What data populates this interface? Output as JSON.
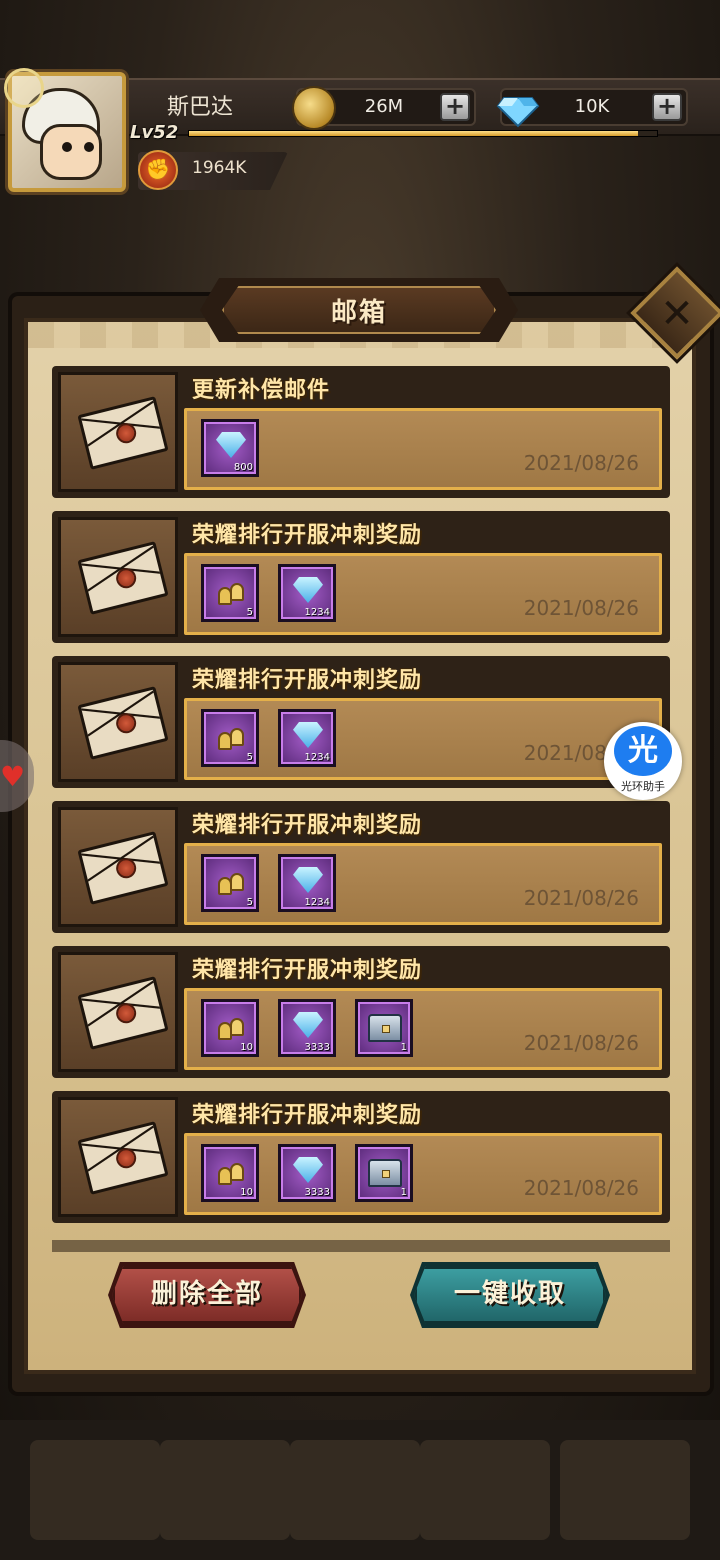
{
  "header": {
    "player_name": "斯巴达",
    "level": "Lv52",
    "power": "1964K",
    "gold": "26M",
    "gems": "10K",
    "xp_progress": 0.96
  },
  "mailbox": {
    "title": "邮箱",
    "close_icon": "close-icon",
    "mails": [
      {
        "title": "更新补偿邮件",
        "date": "2021/08/26",
        "rewards": [
          {
            "icon": "gem-icon",
            "count": "800"
          }
        ]
      },
      {
        "title": "荣耀排行开服冲刺奖励",
        "date": "2021/08/26",
        "rewards": [
          {
            "icon": "bell-icon",
            "count": "5"
          },
          {
            "icon": "gem-icon",
            "count": "1234"
          }
        ]
      },
      {
        "title": "荣耀排行开服冲刺奖励",
        "date": "2021/08/26",
        "rewards": [
          {
            "icon": "bell-icon",
            "count": "5"
          },
          {
            "icon": "gem-icon",
            "count": "1234"
          }
        ]
      },
      {
        "title": "荣耀排行开服冲刺奖励",
        "date": "2021/08/26",
        "rewards": [
          {
            "icon": "bell-icon",
            "count": "5"
          },
          {
            "icon": "gem-icon",
            "count": "1234"
          }
        ]
      },
      {
        "title": "荣耀排行开服冲刺奖励",
        "date": "2021/08/26",
        "rewards": [
          {
            "icon": "bell-icon",
            "count": "10"
          },
          {
            "icon": "gem-icon",
            "count": "3333"
          },
          {
            "icon": "chest-icon",
            "count": "1"
          }
        ]
      },
      {
        "title": "荣耀排行开服冲刺奖励",
        "date": "2021/08/26",
        "rewards": [
          {
            "icon": "bell-icon",
            "count": "10"
          },
          {
            "icon": "gem-icon",
            "count": "3333"
          },
          {
            "icon": "chest-icon",
            "count": "1"
          }
        ]
      }
    ],
    "delete_all_label": "删除全部",
    "collect_all_label": "一键收取"
  },
  "helper": {
    "glyph": "光",
    "label": "光环助手"
  },
  "colors": {
    "title_gold": "#ffe6a8",
    "reward_purple": "#a35cc7",
    "delete_red": "#b5524a",
    "collect_teal": "#3ea1a4",
    "helper_blue": "#1e7df0"
  }
}
